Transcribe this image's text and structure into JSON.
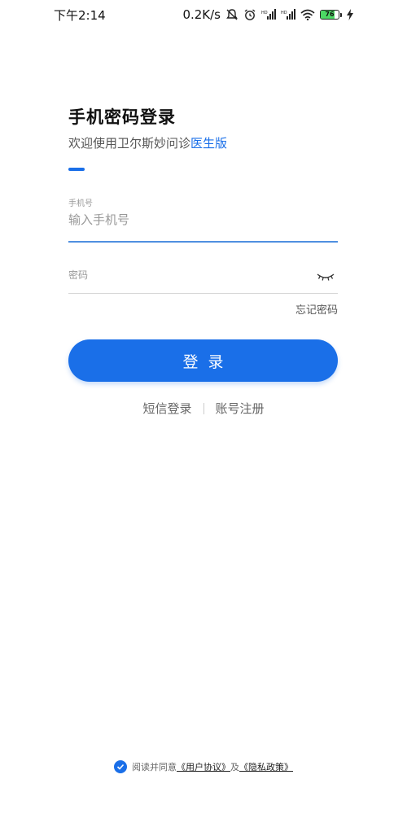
{
  "status_bar": {
    "time": "下午2:14",
    "network_speed": "0.2K/s",
    "battery_level": "76",
    "battery_percent": 76,
    "icons": [
      "mute-icon",
      "alarm-icon",
      "signal-hd-icon",
      "signal-hd-icon",
      "wifi-icon",
      "battery-icon",
      "charging-icon"
    ]
  },
  "header": {
    "title": "手机密码登录",
    "subtitle_prefix": "欢迎使用卫尔斯妙问诊",
    "subtitle_accent": "医生版"
  },
  "form": {
    "phone_label": "手机号",
    "phone_placeholder": "输入手机号",
    "phone_value": "",
    "password_label": "密码",
    "password_value": "",
    "forgot_label": "忘记密码",
    "login_label": "登录"
  },
  "alt_links": {
    "sms_login": "短信登录",
    "register": "账号注册"
  },
  "agreement": {
    "prefix": "阅读并同意",
    "user_agreement": "《用户协议》",
    "and": "及",
    "privacy_policy": "《隐私政策》",
    "checked": true
  },
  "colors": {
    "accent": "#1a6fe8",
    "battery": "#4cd964"
  }
}
